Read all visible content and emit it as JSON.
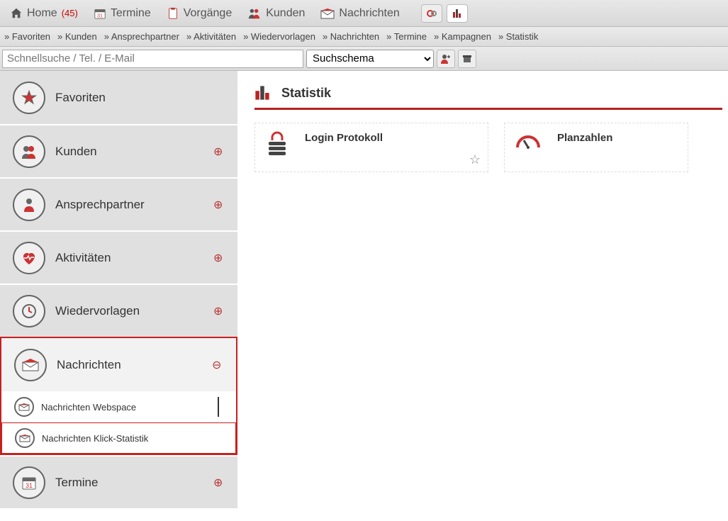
{
  "topnav": {
    "items": [
      {
        "label": "Home",
        "count": "(45)"
      },
      {
        "label": "Termine"
      },
      {
        "label": "Vorgänge"
      },
      {
        "label": "Kunden"
      },
      {
        "label": "Nachrichten"
      }
    ]
  },
  "breadcrumb": {
    "items": [
      "» Favoriten",
      "» Kunden",
      "» Ansprechpartner",
      "» Aktivitäten",
      "» Wiedervorlagen",
      "» Nachrichten",
      "» Termine",
      "» Kampagnen",
      "» Statistik"
    ]
  },
  "search": {
    "placeholder": "Schnellsuche / Tel. / E-Mail",
    "schema_label": "Suchschema"
  },
  "sidebar": {
    "items": [
      {
        "label": "Favoriten",
        "expand": ""
      },
      {
        "label": "Kunden",
        "expand": "⊕"
      },
      {
        "label": "Ansprechpartner",
        "expand": "⊕"
      },
      {
        "label": "Aktivitäten",
        "expand": "⊕"
      },
      {
        "label": "Wiedervorlagen",
        "expand": "⊕"
      },
      {
        "label": "Nachrichten",
        "expand": "⊖",
        "children": [
          {
            "label": "Nachrichten Webspace"
          },
          {
            "label": "Nachrichten Klick-Statistik"
          }
        ]
      },
      {
        "label": "Termine",
        "expand": "⊕"
      }
    ]
  },
  "page": {
    "title": "Statistik",
    "tiles": [
      {
        "label": "Login Protokoll"
      },
      {
        "label": "Planzahlen"
      }
    ]
  }
}
